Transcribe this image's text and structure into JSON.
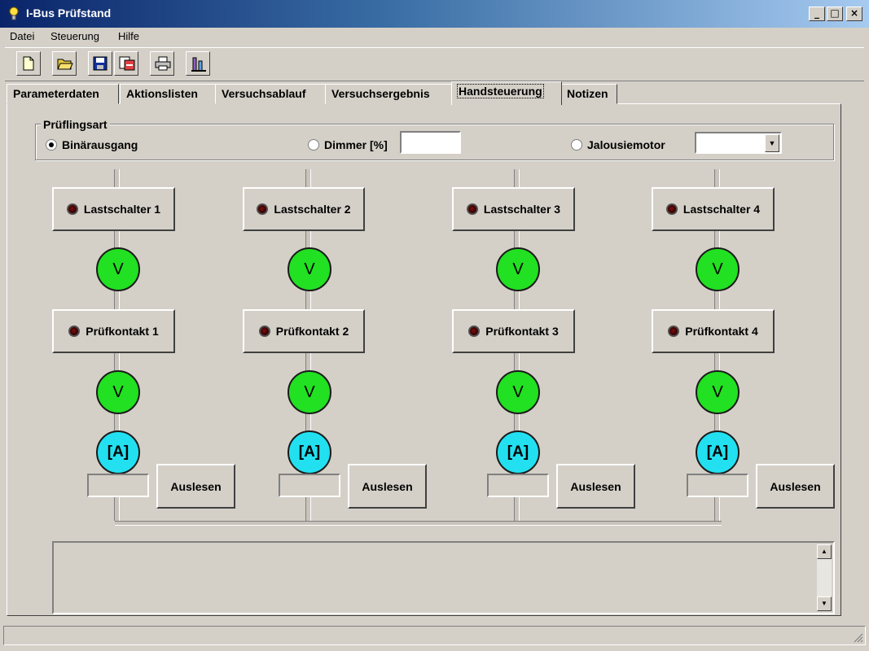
{
  "window": {
    "title": "I-Bus Prüfstand",
    "controls": {
      "minimize": "_",
      "maximize": "□",
      "close": "×"
    }
  },
  "menu": [
    {
      "label": "Datei"
    },
    {
      "label": "Steuerung"
    },
    {
      "label": "Hilfe"
    }
  ],
  "toolbar": {
    "buttons": [
      "new-file-icon",
      "open-folder-icon",
      "save-icon",
      "export-icon",
      "print-icon",
      "test-tube-icon"
    ]
  },
  "tabs": [
    {
      "label": "Parameterdaten"
    },
    {
      "label": "Aktionslisten"
    },
    {
      "label": "Versuchsablauf"
    },
    {
      "label": "Versuchsergebnis"
    },
    {
      "label": "Handsteuerung",
      "active": true
    },
    {
      "label": "Notizen"
    }
  ],
  "pruflingsart": {
    "legend": "Prüflingsart",
    "options": [
      {
        "label": "Binärausgang",
        "selected": true
      },
      {
        "label": "Dimmer [%]",
        "selected": false,
        "value": ""
      },
      {
        "label": "Jalousiemotor",
        "selected": false,
        "value": ""
      }
    ]
  },
  "channels": [
    {
      "lastschalter": "Lastschalter 1",
      "pruefkontakt": "Prüfkontakt 1",
      "voltmeter": "V",
      "amperemeter": "[A]",
      "value": "",
      "read_button": "Auslesen"
    },
    {
      "lastschalter": "Lastschalter 2",
      "pruefkontakt": "Prüfkontakt 2",
      "voltmeter": "V",
      "amperemeter": "[A]",
      "value": "",
      "read_button": "Auslesen"
    },
    {
      "lastschalter": "Lastschalter 3",
      "pruefkontakt": "Prüfkontakt 3",
      "voltmeter": "V",
      "amperemeter": "[A]",
      "value": "",
      "read_button": "Auslesen"
    },
    {
      "lastschalter": "Lastschalter 4",
      "pruefkontakt": "Prüfkontakt 4",
      "voltmeter": "V",
      "amperemeter": "[A]",
      "value": "",
      "read_button": "Auslesen"
    }
  ],
  "log": {
    "text": ""
  },
  "colors": {
    "voltmeter": "#22e022",
    "amperemeter": "#22e0f0",
    "led_off": "#3a0000"
  }
}
